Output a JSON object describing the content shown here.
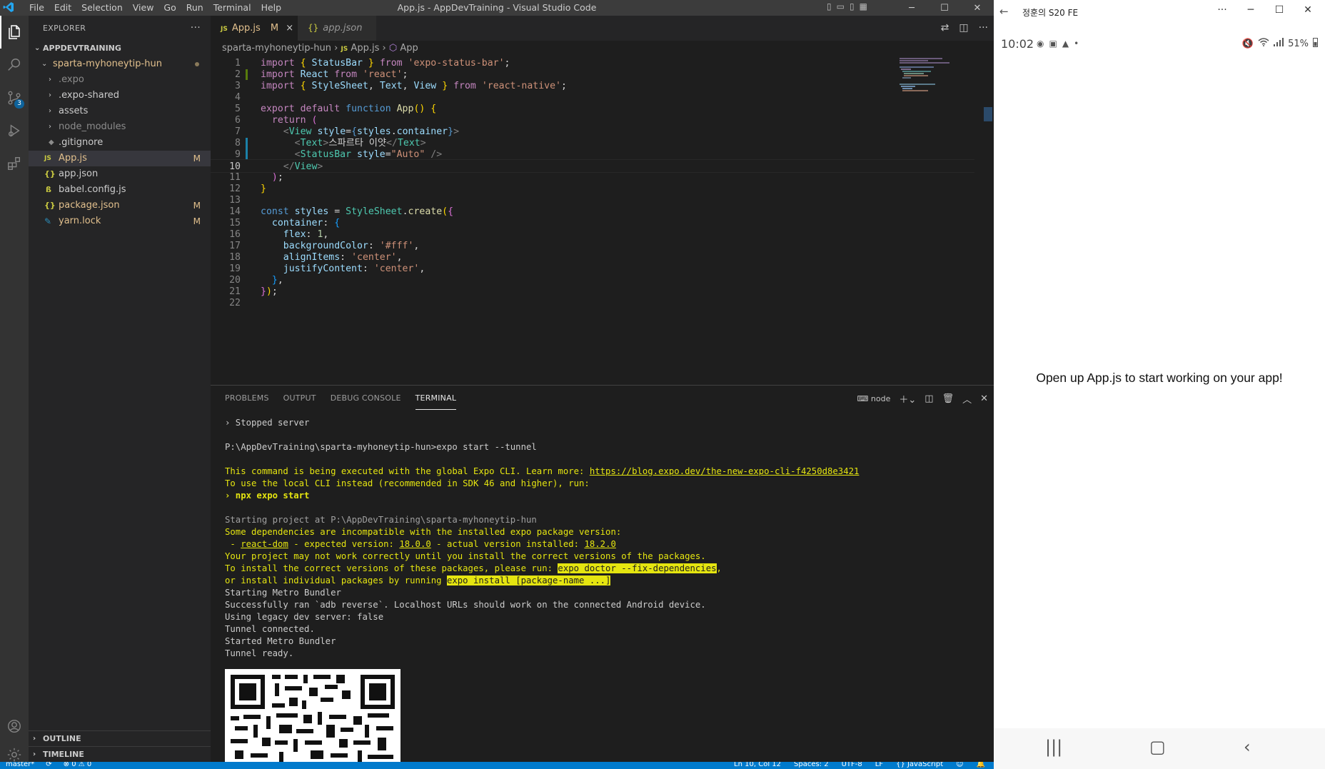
{
  "vscode": {
    "title": "App.js - AppDevTraining - Visual Studio Code",
    "menu": [
      "File",
      "Edit",
      "Selection",
      "View",
      "Go",
      "Run",
      "Terminal",
      "Help"
    ],
    "activity_badge": "3",
    "explorer": {
      "header": "EXPLORER",
      "root": "APPDEVTRAINING",
      "project": "sparta-myhoneytip-hun",
      "items": [
        {
          "label": ".expo",
          "kind": "folder",
          "status": ""
        },
        {
          "label": ".expo-shared",
          "kind": "folder",
          "status": ""
        },
        {
          "label": "assets",
          "kind": "folder",
          "status": ""
        },
        {
          "label": "node_modules",
          "kind": "folder",
          "status": ""
        },
        {
          "label": ".gitignore",
          "kind": "file",
          "status": ""
        },
        {
          "label": "App.js",
          "kind": "js",
          "status": "M"
        },
        {
          "label": "app.json",
          "kind": "json",
          "status": ""
        },
        {
          "label": "babel.config.js",
          "kind": "babel",
          "status": ""
        },
        {
          "label": "package.json",
          "kind": "json",
          "status": "M"
        },
        {
          "label": "yarn.lock",
          "kind": "yarn",
          "status": "M"
        }
      ],
      "outline": "OUTLINE",
      "timeline": "TIMELINE"
    },
    "tabs": [
      {
        "icon": "JS",
        "label": "App.js",
        "status": "M",
        "close": "×"
      },
      {
        "icon": "{}",
        "label": "app.json"
      }
    ],
    "breadcrumb": [
      "sparta-myhoneytip-hun",
      "App.js",
      "App"
    ],
    "code": {
      "cursor_line": 10,
      "lines": [
        "import { StatusBar } from 'expo-status-bar';",
        "import React from 'react';",
        "import { StyleSheet, Text, View } from 'react-native';",
        "",
        "export default function App() {",
        "  return (",
        "    <View style={styles.container}>",
        "      <Text>스파르타 이얏</Text>",
        "      <StatusBar style=\"Auto\" />",
        "    </View>",
        "  );",
        "}",
        "",
        "const styles = StyleSheet.create({",
        "  container: {",
        "    flex: 1,",
        "    backgroundColor: '#fff',",
        "    alignItems: 'center',",
        "    justifyContent: 'center',",
        "  },",
        "});",
        ""
      ]
    },
    "panel": {
      "tabs": [
        "PROBLEMS",
        "OUTPUT",
        "DEBUG CONSOLE",
        "TERMINAL"
      ],
      "active_tab": "TERMINAL",
      "terminal_name": "node",
      "terminal": {
        "stopped": "› Stopped server",
        "prompt": "P:\\AppDevTraining\\sparta-myhoneytip-hun>expo start --tunnel",
        "global_cli_prefix": "This command is being executed with the global Expo CLI. Learn more: ",
        "global_cli_link": "https://blog.expo.dev/the-new-expo-cli-f4250d8e3421",
        "local_cli": "To use the local CLI instead (recommended in SDK 46 and higher), run:",
        "npx": "› npx expo start",
        "starting": "Starting project at P:\\AppDevTraining\\sparta-myhoneytip-hun",
        "incompat": "Some dependencies are incompatible with the installed expo package version:",
        "dep_prefix": " - ",
        "dep_name": "react-dom",
        "dep_mid1": " - expected version: ",
        "dep_expected": "18.0.0",
        "dep_mid2": " - actual version installed: ",
        "dep_actual": "18.2.0",
        "may_not_work": "Your project may not work correctly until you install the correct versions of the packages.",
        "install_prefix": "To install the correct versions of these packages, please run: ",
        "install_cmd": "expo doctor --fix-dependencies",
        "install_suffix": ",",
        "individual_prefix": "or install individual packages by running ",
        "individual_cmd": "expo install [package-name ...]",
        "log": [
          "Starting Metro Bundler",
          "Successfully ran `adb reverse`. Localhost URLs should work on the connected Android device.",
          "Using legacy dev server: false",
          "Tunnel connected.",
          "Started Metro Bundler",
          "Tunnel ready."
        ]
      }
    },
    "statusbar": {
      "branch": "master*",
      "problems": "⊗ 0 ⚠ 0",
      "position": "Ln 10, Col 12",
      "spaces": "Spaces: 2",
      "encoding": "UTF-8",
      "eol": "LF",
      "language": "{} JavaScript"
    }
  },
  "phone": {
    "window_title": "정훈의 S20 FE",
    "time": "10:02",
    "battery": "51%",
    "message": "Open up App.js to start working on your app!"
  },
  "colors": {
    "accent": "#007acc",
    "terminal_yellow": "#e5e510",
    "modified": "#e2c08d"
  }
}
